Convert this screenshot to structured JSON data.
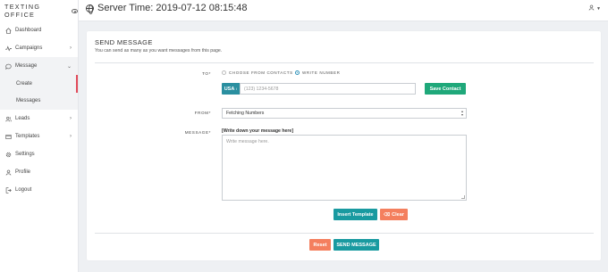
{
  "brand": "TEXTING OFFICE",
  "sidebar": {
    "items": [
      {
        "label": "Dashboard",
        "icon": "home-icon"
      },
      {
        "label": "Campaigns",
        "icon": "pulse-icon"
      },
      {
        "label": "Message",
        "icon": "chat-icon",
        "open": true
      },
      {
        "label": "Create",
        "sub": true,
        "active": true
      },
      {
        "label": "Messages",
        "sub": true
      },
      {
        "label": "Leads",
        "icon": "users-icon"
      },
      {
        "label": "Templates",
        "icon": "template-icon"
      },
      {
        "label": "Settings",
        "icon": "gear-icon"
      },
      {
        "label": "Profile",
        "icon": "user-icon"
      },
      {
        "label": "Logout",
        "icon": "logout-icon"
      }
    ]
  },
  "header": {
    "server_time": "Server Time: 2019-07-12 08:15:48"
  },
  "card": {
    "title": "SEND MESSAGE",
    "subtitle": "You can send as many as you want messages from this page.",
    "to_label": "TO*",
    "radio_contacts": "CHOOSE FROM CONTACTS",
    "radio_write": "WRITE NUMBER",
    "country": "USA",
    "phone_placeholder": "(123) 1234-5678",
    "save_contact": "Save Contact",
    "from_label": "FROM*",
    "from_value": "Fetching Numbers",
    "message_label": "MESSAGE*",
    "message_heading": "[Write down your message here]",
    "message_placeholder": "Write message here.",
    "insert_template": "Insert Template",
    "clear": "Clear",
    "reset": "Reset",
    "send": "SEND MESSAGE"
  },
  "colors": {
    "accent_teal": "#199aa0",
    "accent_green": "#1fa87a",
    "accent_orange": "#f47f5e",
    "active_marker": "#e14a5a"
  }
}
